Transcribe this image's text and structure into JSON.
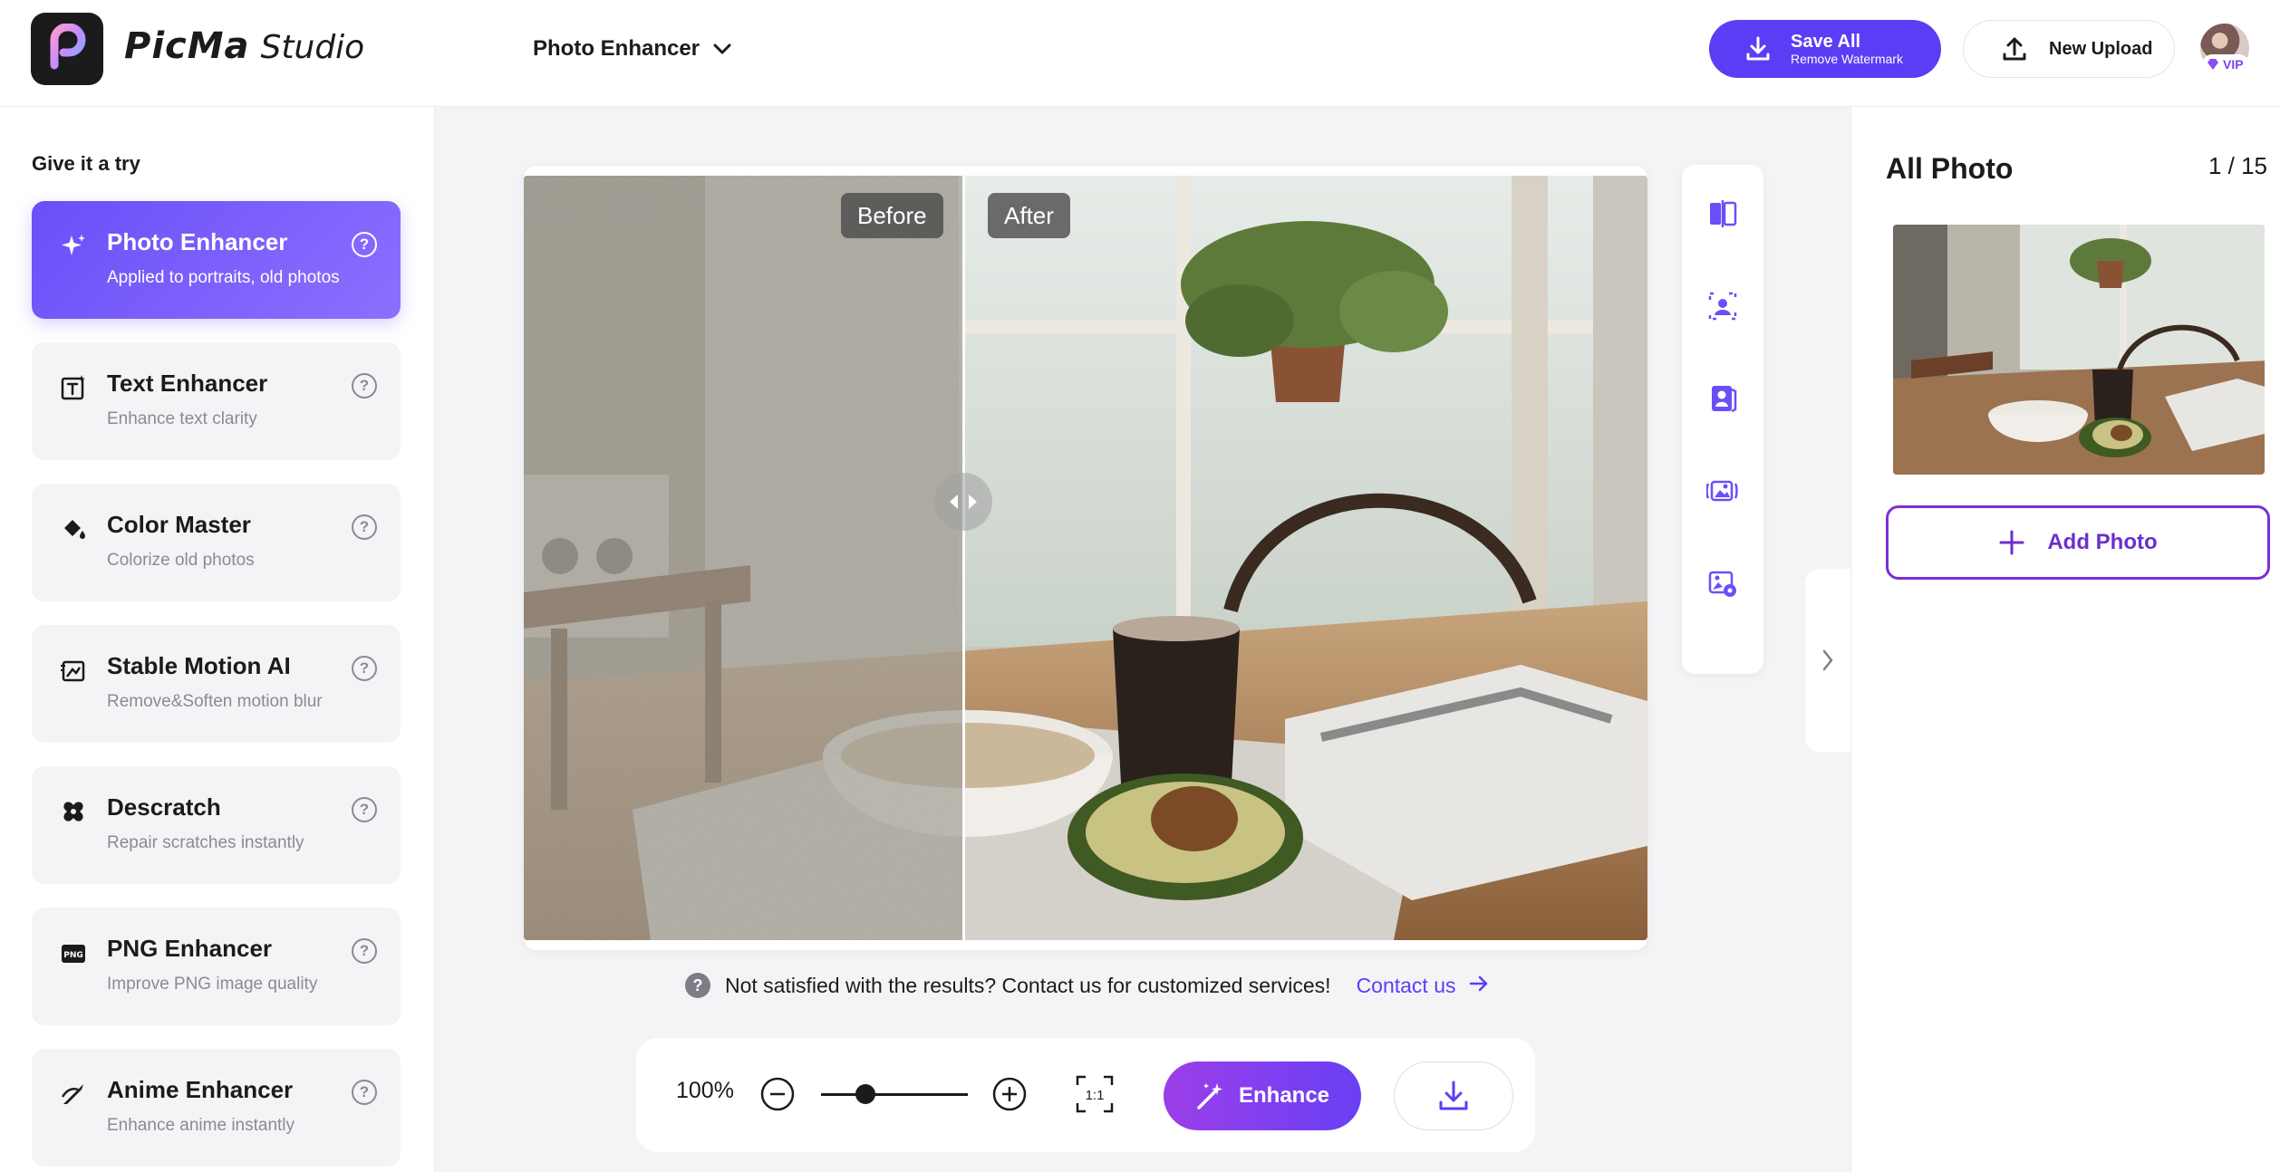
{
  "app": {
    "brand_main": "PicMa",
    "brand_sub": "Studio",
    "current_tool": "Photo Enhancer"
  },
  "header": {
    "save_all_label": "Save All",
    "save_all_sub": "Remove Watermark",
    "new_upload_label": "New Upload",
    "vip_label": "VIP"
  },
  "sidebar": {
    "heading": "Give it a try",
    "tools": [
      {
        "name": "Photo Enhancer",
        "desc": "Applied to portraits, old photos",
        "icon": "sparkle-icon",
        "active": true
      },
      {
        "name": "Text Enhancer",
        "desc": "Enhance text clarity",
        "icon": "text-icon",
        "active": false
      },
      {
        "name": "Color Master",
        "desc": "Colorize old photos",
        "icon": "paint-bucket-icon",
        "active": false
      },
      {
        "name": "Stable Motion AI",
        "desc": "Remove&Soften motion blur",
        "icon": "motion-icon",
        "active": false
      },
      {
        "name": "Descratch",
        "desc": "Repair scratches instantly",
        "icon": "bandage-icon",
        "active": false
      },
      {
        "name": "PNG Enhancer",
        "desc": "Improve PNG image quality",
        "icon": "png-icon",
        "active": false
      },
      {
        "name": "Anime Enhancer",
        "desc": "Enhance anime instantly",
        "icon": "brush-icon",
        "active": false
      }
    ]
  },
  "preview": {
    "before_label": "Before",
    "after_label": "After",
    "split_position": 0.39
  },
  "rail": {
    "tools": [
      "compare-split-icon",
      "face-scan-icon",
      "portrait-card-icon",
      "image-sound-icon",
      "image-settings-icon"
    ]
  },
  "help": {
    "text": "Not satisfied with the results? Contact us for customized services!",
    "contact_label": "Contact us"
  },
  "toolbar": {
    "zoom_value": "100%",
    "zoom_level": 0.3,
    "fit_label": "1:1",
    "enhance_label": "Enhance"
  },
  "right_panel": {
    "title": "All Photo",
    "counter": "1 / 15",
    "add_photo_label": "Add Photo"
  },
  "colors": {
    "accent": "#5b3df5",
    "accent_purple": "#7b2fd6",
    "active_card": "#6b4ef8"
  }
}
